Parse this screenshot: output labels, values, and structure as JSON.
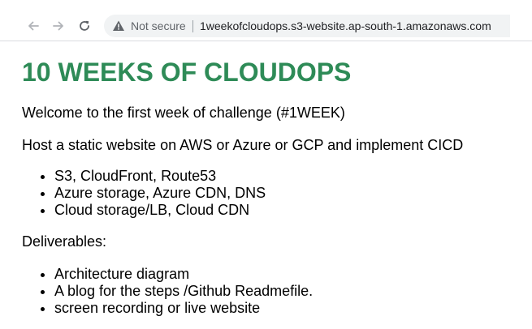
{
  "browser": {
    "security_label": "Not secure",
    "url": "1weekofcloudops.s3-website.ap-south-1.amazonaws.com",
    "icons": {
      "back": "back-arrow-icon",
      "forward": "forward-arrow-icon",
      "reload": "reload-icon",
      "warning": "warning-triangle-icon"
    }
  },
  "page": {
    "heading": "10 WEEKS OF CLOUDOPS",
    "heading_color": "#2e8b57",
    "welcome": "Welcome to the first week of challenge (#1WEEK)",
    "task": "Host a static website on AWS or Azure or GCP and implement CICD",
    "options": [
      "S3, CloudFront, Route53",
      "Azure storage, Azure CDN, DNS",
      "Cloud storage/LB, Cloud CDN"
    ],
    "deliverables_label": "Deliverables:",
    "deliverables": [
      "Architecture diagram",
      "A blog for the steps /Github Readmefile.",
      "screen recording or live website"
    ]
  }
}
